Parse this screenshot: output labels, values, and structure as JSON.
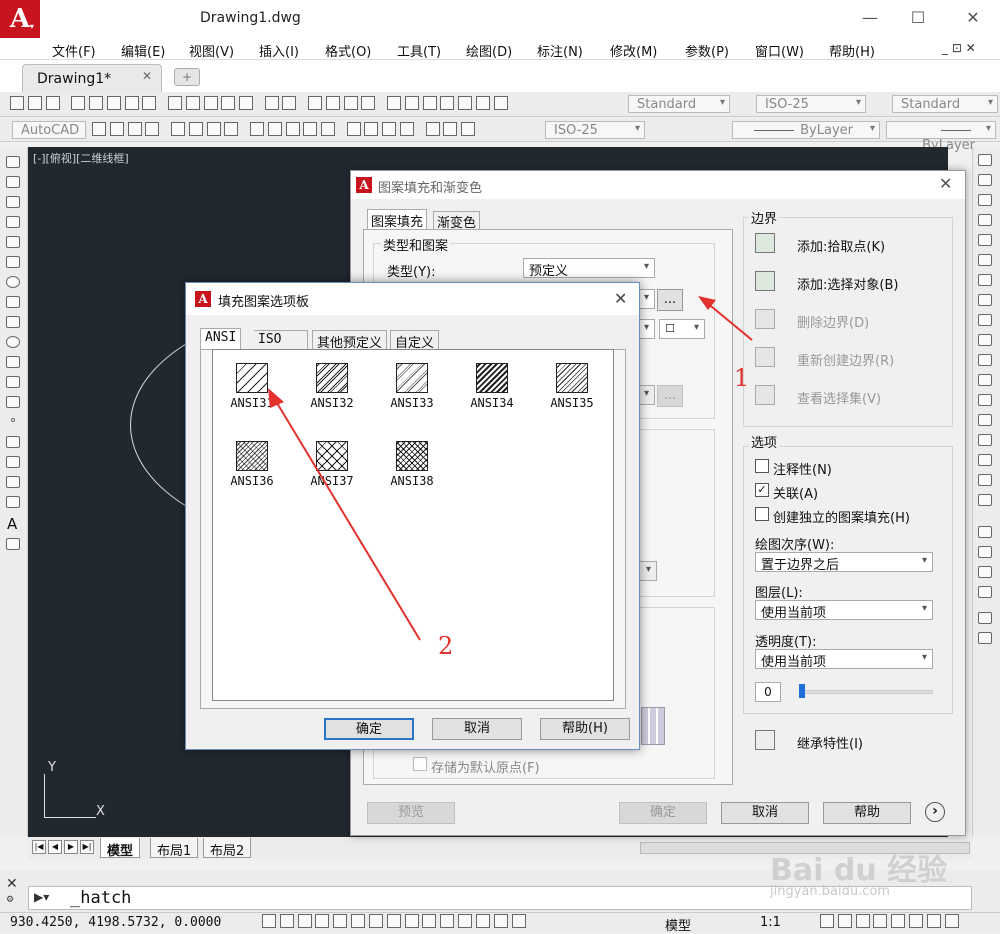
{
  "window": {
    "title": "Drawing1.dwg",
    "logo": "A",
    "minimize": "—",
    "maximize": "☐",
    "close": "✕",
    "mdi_controls": "_ ⊡ ✕"
  },
  "menu": [
    "文件(F)",
    "编辑(E)",
    "视图(V)",
    "插入(I)",
    "格式(O)",
    "工具(T)",
    "绘图(D)",
    "标注(N)",
    "修改(M)",
    "参数(P)",
    "窗口(W)",
    "帮助(H)"
  ],
  "doc_tab": {
    "label": "Drawing1*",
    "close": "✕"
  },
  "toolbar": {
    "text_style": "Standard",
    "dim_style": "ISO-25",
    "table_style": "Standard",
    "workspace": "AutoCAD",
    "dim_style2": "ISO-25",
    "linetype": "ByLayer",
    "lineweight": "ByLayer"
  },
  "viewport_label": "[-][俯视][二维线框]",
  "ucs": {
    "y": "Y",
    "x": "X"
  },
  "layout_tabs": [
    "模型",
    "布局1",
    "布局2"
  ],
  "command": {
    "prefix": "▶▾",
    "text": "_hatch"
  },
  "status": {
    "coords": "930.4250,  4198.5732,  0.0000",
    "model": "模型",
    "scale": "1:1"
  },
  "hatch_dialog": {
    "title": "图案填充和渐变色",
    "tabs": [
      "图案填充",
      "渐变色"
    ],
    "type_group": "类型和图案",
    "type_label": "类型(Y):",
    "type_value": "预定义",
    "browse": "...",
    "store_origin": "存储为默认原点(F)",
    "preview": "预览",
    "ok": "确定",
    "cancel": "取消",
    "help": "帮助",
    "expand": "›",
    "boundary_title": "边界",
    "boundary_actions": [
      {
        "label": "添加:拾取点(K)",
        "enabled": true
      },
      {
        "label": "添加:选择对象(B)",
        "enabled": true
      },
      {
        "label": "删除边界(D)",
        "enabled": false
      },
      {
        "label": "重新创建边界(R)",
        "enabled": false
      },
      {
        "label": "查看选择集(V)",
        "enabled": false
      }
    ],
    "options_title": "选项",
    "annotative": {
      "label": "注释性(N)",
      "checked": false
    },
    "associative": {
      "label": "关联(A)",
      "checked": true
    },
    "separate": {
      "label": "创建独立的图案填充(H)",
      "checked": false
    },
    "draw_order_label": "绘图次序(W):",
    "draw_order_value": "置于边界之后",
    "layer_label": "图层(L):",
    "layer_value": "使用当前项",
    "transparency_label": "透明度(T):",
    "transparency_value": "使用当前项",
    "transparency_number": "0",
    "inherit": "继承特性(I)"
  },
  "palette": {
    "title": "填充图案选项板",
    "close": "✕",
    "tabs": [
      "ANSI",
      "ISO",
      "其他预定义",
      "自定义"
    ],
    "patterns": [
      "ANSI31",
      "ANSI32",
      "ANSI33",
      "ANSI34",
      "ANSI35",
      "ANSI36",
      "ANSI37",
      "ANSI38"
    ],
    "ok": "确定",
    "cancel": "取消",
    "help": "帮助(H)"
  },
  "annotations": {
    "arrow1": "1",
    "arrow2": "2"
  },
  "watermark": {
    "brand": "Bai du 经验",
    "url": "jingyan.baidu.com"
  }
}
